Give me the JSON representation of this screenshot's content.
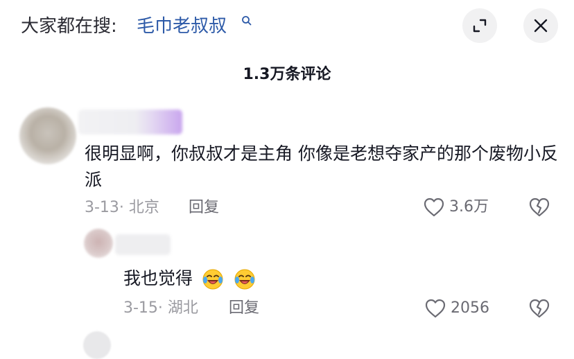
{
  "header": {
    "search_prefix": "大家都在搜:",
    "search_term": "毛巾老叔叔",
    "expand_icon": "expand-icon",
    "close_icon": "close-icon"
  },
  "comments_header": {
    "count_label": "1.3万条评论"
  },
  "comments": [
    {
      "text": "很明显啊，你叔叔才是主角 你像是老想夺家产的那个废物小反派",
      "date_location": "3-13· 北京",
      "reply_label": "回复",
      "likes": "3.6万",
      "like_icon": "heart-outline-icon",
      "dislike_icon": "broken-heart-icon"
    }
  ],
  "replies": [
    {
      "text": "我也觉得",
      "emoji": [
        "laugh-cry-emoji",
        "laugh-cry-emoji"
      ],
      "date_location": "3-15· 湖北",
      "reply_label": "回复",
      "likes": "2056",
      "like_icon": "heart-outline-icon",
      "dislike_icon": "broken-heart-icon"
    }
  ],
  "colors": {
    "link": "#2d5aa8",
    "meta": "#9a9aa0",
    "button_bg": "#f1f1f2"
  }
}
